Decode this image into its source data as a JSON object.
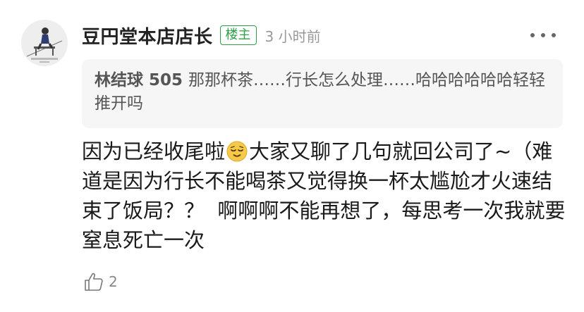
{
  "comment": {
    "username": "豆円堂本店店长",
    "badge": "楼主",
    "timestamp": "3 小时前",
    "quote": {
      "author": "林结球 505",
      "text": "那那杯茶……行长怎么处理……哈哈哈哈哈哈轻轻推开吗"
    },
    "body_before_emoji": "因为已经收尾啦",
    "emoji": "relieved-face-emoji",
    "body_after_emoji": "大家又聊了几句就回公司了~（难道是因为行长不能喝茶又觉得换一杯太尴尬才火速结束了饭局？？  啊啊啊不能再想了，每思考一次我就要窒息死亡一次",
    "like_count": "2"
  },
  "icons": {
    "more": "more-horizontal-icon",
    "like": "thumbs-up-icon",
    "emoji": "relieved-face-emoji"
  },
  "colors": {
    "badge_green": "#2e9f46",
    "quote_background": "#f6f6f6",
    "timestamp_gray": "#999999",
    "emoji_yellow": "#f7c948"
  }
}
